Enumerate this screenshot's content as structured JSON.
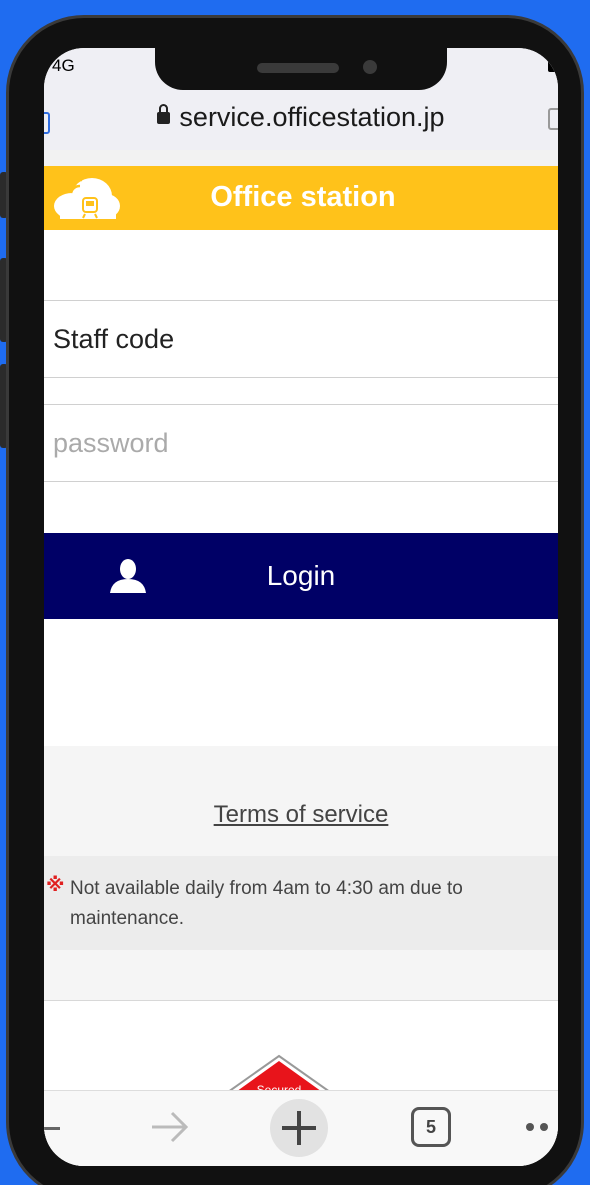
{
  "status": {
    "carrier": "4G"
  },
  "browser": {
    "url": "service.officestation.jp",
    "tab_count": "5"
  },
  "app": {
    "title": "Office station"
  },
  "form": {
    "staff_code_placeholder": "Staff code",
    "password_placeholder": "password",
    "login_label": "Login"
  },
  "footer": {
    "terms_link": "Terms of service",
    "notice_mark": "※",
    "notice_text": "Not available daily from 4am to 4:30 am due to maintenance.",
    "badge_text": "Secured"
  },
  "colors": {
    "background": "#1f6cf0",
    "app_bar": "#ffc21a",
    "login_button": "#000066",
    "notice_mark": "#e02020"
  },
  "icons": [
    "lock-icon",
    "cloud-train-logo",
    "user-icon",
    "forward-arrow-icon",
    "plus-icon",
    "tabs-icon",
    "more-icon",
    "secured-badge"
  ]
}
